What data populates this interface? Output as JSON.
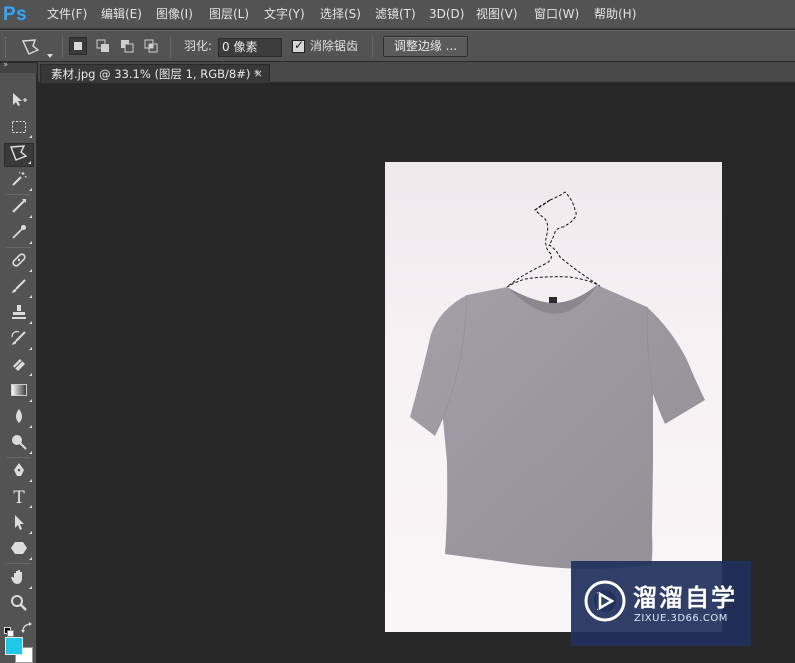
{
  "app": {
    "logo": "Ps",
    "menu": [
      {
        "label": "文件(F)"
      },
      {
        "label": "编辑(E)"
      },
      {
        "label": "图像(I)"
      },
      {
        "label": "图层(L)"
      },
      {
        "label": "文字(Y)"
      },
      {
        "label": "选择(S)"
      },
      {
        "label": "滤镜(T)"
      },
      {
        "label": "3D(D)"
      },
      {
        "label": "视图(V)"
      },
      {
        "label": "窗口(W)"
      },
      {
        "label": "帮助(H)"
      }
    ]
  },
  "options": {
    "tool_icon": "polygonal-lasso-icon",
    "selection_modes": [
      "new-selection-icon",
      "add-to-selection-icon",
      "subtract-from-selection-icon",
      "intersect-selection-icon"
    ],
    "feather_label": "羽化:",
    "feather_value": "0 像素",
    "antialias_checked": true,
    "antialias_label": "消除锯齿",
    "refine_edge_label": "调整边缘 ..."
  },
  "document": {
    "tab_title": "素材.jpg @ 33.1% (图层 1, RGB/8#) *",
    "close_glyph": "×"
  },
  "tools": [
    {
      "icon": "move-icon"
    },
    {
      "icon": "rectangular-marquee-icon"
    },
    {
      "icon": "polygonal-lasso-icon",
      "active": true
    },
    {
      "icon": "magic-wand-icon"
    },
    {
      "icon": "crop-icon"
    },
    {
      "icon": "eyedropper-icon"
    },
    {
      "icon": "healing-brush-icon"
    },
    {
      "icon": "brush-icon"
    },
    {
      "icon": "clone-stamp-icon"
    },
    {
      "icon": "history-brush-icon"
    },
    {
      "icon": "eraser-icon"
    },
    {
      "icon": "gradient-icon"
    },
    {
      "icon": "blur-icon"
    },
    {
      "icon": "dodge-icon"
    },
    {
      "icon": "pen-icon"
    },
    {
      "icon": "type-icon",
      "glyph": "T"
    },
    {
      "icon": "path-selection-icon"
    },
    {
      "icon": "shape-icon"
    },
    {
      "icon": "hand-icon"
    },
    {
      "icon": "zoom-icon"
    }
  ],
  "colors": {
    "foreground": "#1ec8e6",
    "background": "#ffffff",
    "ps_blue": "#31a8ff"
  },
  "watermark": {
    "brand": "溜溜自学",
    "url": "ZIXUE.3D66.COM"
  }
}
